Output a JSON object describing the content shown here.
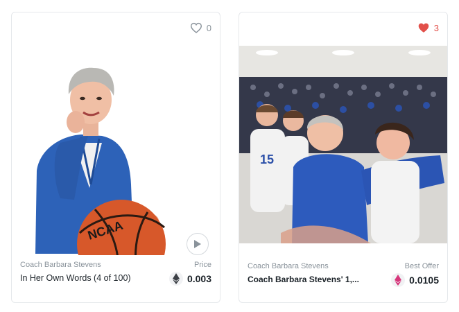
{
  "cards": [
    {
      "favorite_count": "0",
      "liked": false,
      "collection": "Coach Barbara Stevens",
      "title": "In Her Own Words (4 of 100)",
      "price_label": "Price",
      "price": "0.003",
      "currency_icon": "eth-gray-icon",
      "media_icon": "play-icon"
    },
    {
      "favorite_count": "3",
      "liked": true,
      "collection": "Coach Barbara Stevens",
      "title": "Coach Barbara Stevens' 1,...",
      "price_label": "Best Offer",
      "price": "0.0105",
      "currency_icon": "weth-pink-icon"
    }
  ],
  "colors": {
    "like": "#e2504a",
    "muted": "#8a939b",
    "text": "#1b2228",
    "weth": "#d6367a"
  }
}
